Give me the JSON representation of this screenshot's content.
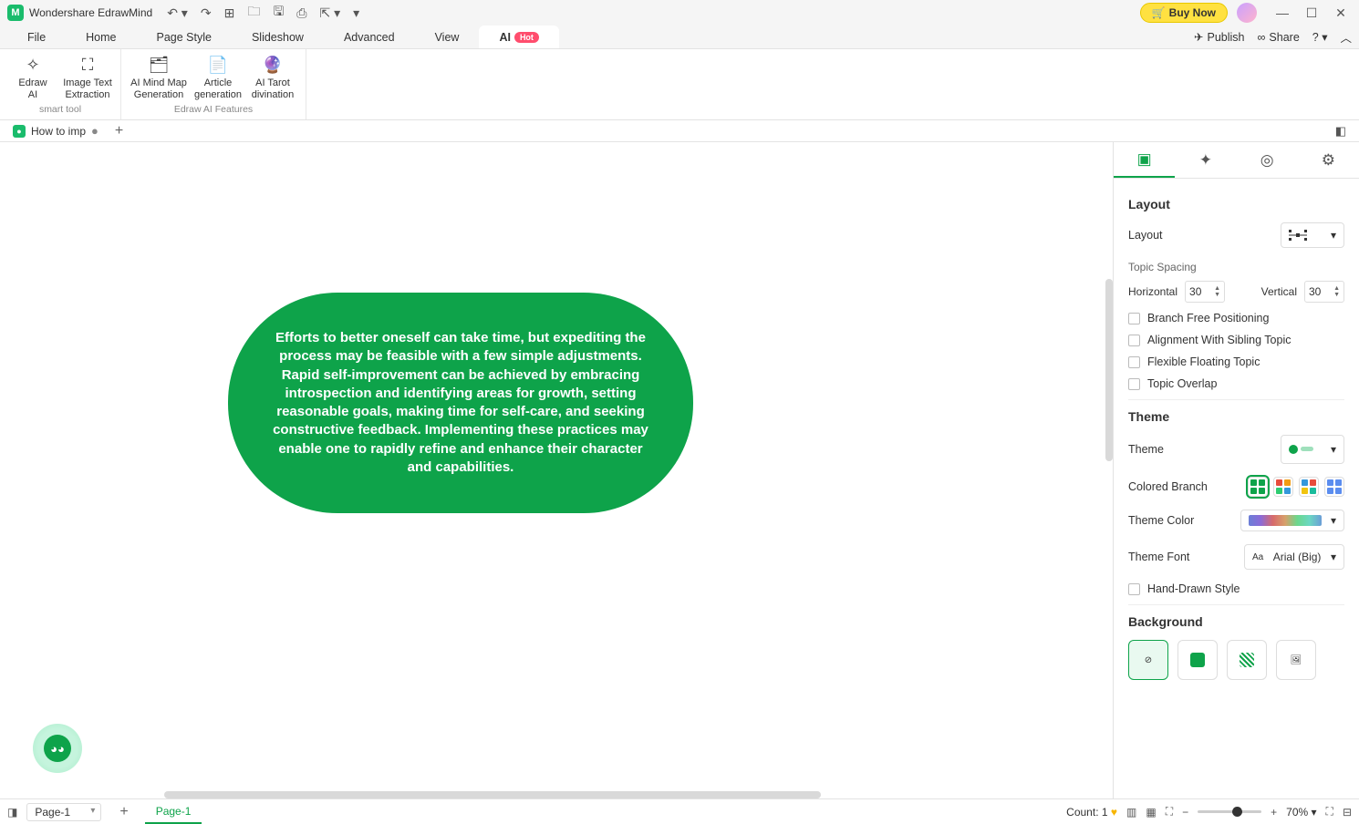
{
  "titlebar": {
    "app_name": "Wondershare EdrawMind",
    "buy_now": "Buy Now"
  },
  "menu": {
    "items": [
      "File",
      "Home",
      "Page Style",
      "Slideshow",
      "Advanced",
      "View",
      "AI"
    ],
    "hot_badge": "Hot",
    "right": {
      "publish": "Publish",
      "share": "Share"
    }
  },
  "ribbon": {
    "group1": {
      "label": "smart tool",
      "btns": [
        {
          "label": "Edraw\nAI"
        },
        {
          "label": "Image Text\nExtraction"
        }
      ]
    },
    "group2": {
      "label": "Edraw AI Features",
      "btns": [
        {
          "label": "AI Mind Map\nGeneration"
        },
        {
          "label": "Article\ngeneration"
        },
        {
          "label": "AI Tarot\ndivination"
        }
      ]
    }
  },
  "doc_tabs": {
    "tab1": "How to imp"
  },
  "canvas": {
    "node_text": "Efforts to better oneself can take time, but expediting the process may be feasible with a few simple adjustments. Rapid self-improvement can be achieved by embracing introspection and identifying areas for growth, setting reasonable goals, making time for self-care, and seeking constructive feedback. Implementing these practices may enable one to rapidly refine and enhance their character and capabilities."
  },
  "panel": {
    "layout": {
      "heading": "Layout",
      "row_label": "Layout",
      "spacing_label": "Topic Spacing",
      "horizontal": "Horizontal",
      "horizontal_val": "30",
      "vertical": "Vertical",
      "vertical_val": "30",
      "branch_free": "Branch Free Positioning",
      "align_sibling": "Alignment With Sibling Topic",
      "flexible": "Flexible Floating Topic",
      "overlap": "Topic Overlap"
    },
    "theme": {
      "heading": "Theme",
      "theme_label": "Theme",
      "colored_branch": "Colored Branch",
      "theme_color": "Theme Color",
      "theme_font": "Theme Font",
      "font_value": "Arial (Big)",
      "hand_drawn": "Hand-Drawn Style"
    },
    "background": {
      "heading": "Background"
    }
  },
  "status": {
    "page_dd": "Page-1",
    "page_pill": "Page-1",
    "count": "Count: 1",
    "zoom": "70%"
  }
}
